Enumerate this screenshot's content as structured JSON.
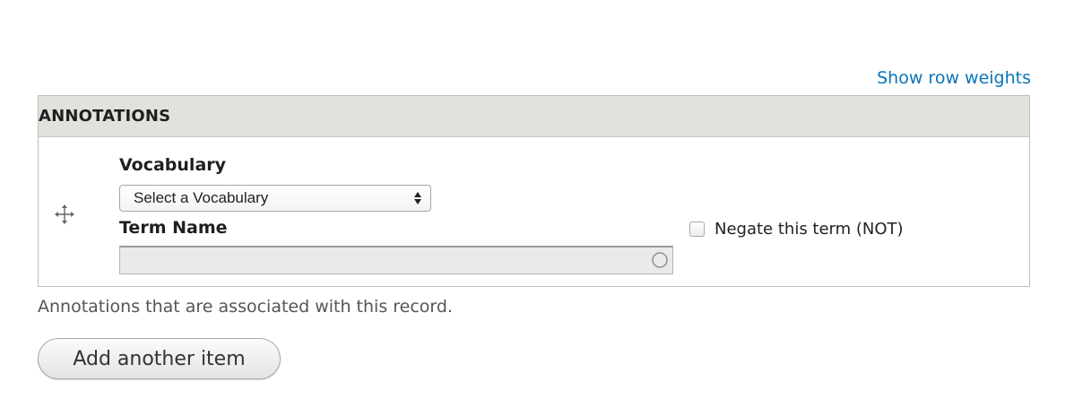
{
  "row_weights_link": "Show row weights",
  "table": {
    "header": "ANNOTATIONS",
    "row": {
      "vocabulary_label": "Vocabulary",
      "vocabulary_select": "Select a Vocabulary",
      "term_label": "Term Name",
      "term_value": "",
      "negate_label": "Negate this term (NOT)",
      "negate_checked": false
    }
  },
  "description": "Annotations that are associated with this record.",
  "add_button": "Add another item",
  "icons": {
    "drag": "move-arrows-icon",
    "select_arrows": "select-updown-icon",
    "autocomplete": "autocomplete-throbber-icon"
  },
  "colors": {
    "link": "#0a74b8",
    "header_bg": "#e2e2dc"
  }
}
